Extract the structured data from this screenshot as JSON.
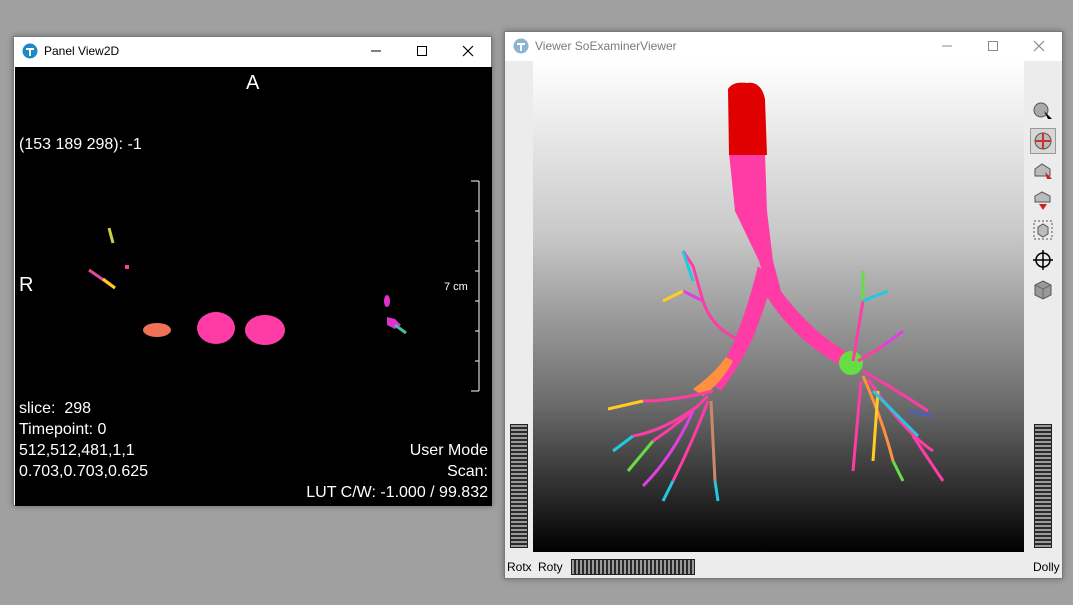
{
  "panel2d": {
    "title": "Panel View2D",
    "orientation_top": "A",
    "orientation_left": "R",
    "probe": "(153 189 298): -1",
    "scale_label": "7 cm",
    "info_left": [
      "slice:  298",
      "Timepoint: 0",
      "512,512,481,1,1",
      "0.703,0.703,0.625"
    ],
    "info_right": [
      "User Mode",
      "Scan:",
      "LUT C/W: -1.000 / 99.832"
    ]
  },
  "viewer3d": {
    "title": "Viewer SoExaminerViewer",
    "tools": [
      "pick-mode",
      "view-mode",
      "home",
      "set-home",
      "view-all",
      "seek",
      "projection"
    ],
    "rotx_label": "Rotx",
    "roty_label": "Roty",
    "dolly_label": "Dolly"
  },
  "colors": {
    "trachea": "#ff3ca5",
    "trachea_top": "#e00000",
    "segment_green": "#66dd44",
    "segment_orange": "#ff9040",
    "segment_cyan": "#22c8e0"
  }
}
